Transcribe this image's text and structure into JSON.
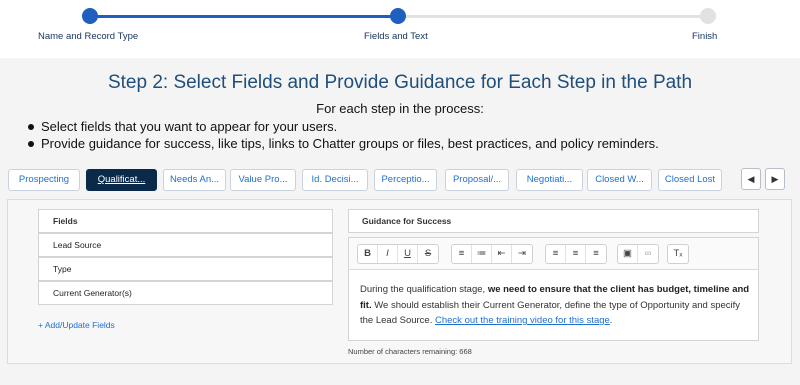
{
  "stepper": {
    "steps": [
      {
        "label": "Name and Record Type",
        "state": "complete"
      },
      {
        "label": "Fields and Text",
        "state": "current"
      },
      {
        "label": "Finish",
        "state": "incomplete"
      }
    ]
  },
  "heading": {
    "title": "Step 2: Select Fields and Provide Guidance for Each Step in the Path",
    "intro": "For each step in the process:",
    "bullets": [
      "Select fields that you want to appear for your users.",
      "Provide guidance for success, like tips, links to Chatter groups or files, best practices, and policy reminders."
    ]
  },
  "stages": {
    "tabs": [
      "Prospecting",
      "Qualificat...",
      "Needs An...",
      "Value Pro...",
      "Id. Decisi...",
      "Perceptio...",
      "Proposal/...",
      "Negotiati...",
      "Closed W...",
      "Closed Lost"
    ],
    "active_index": 1,
    "prev_icon": "chevron-left-icon",
    "next_icon": "chevron-right-icon"
  },
  "fields": {
    "header": "Fields",
    "items": [
      "Lead Source",
      "Type",
      "Current Generator(s)"
    ],
    "add_link": "+ Add/Update Fields"
  },
  "guidance": {
    "header": "Guidance for Success",
    "toolbar": {
      "bold": "B",
      "italic": "I",
      "underline": "U",
      "strike": "S"
    },
    "body": {
      "text1": "During the qualification stage, ",
      "bold": "we need to ensure that the client has budget, timeline and fit.",
      "text2": " We should establish their Current Generator, define the type of Opportunity and specify the Lead Source. ",
      "link": "Check out the training video for this stage",
      "text3": "."
    },
    "chars_remaining": "Number of characters remaining: 668"
  },
  "colors": {
    "accent": "#1f5fbf",
    "active_tab": "#0b2a4a",
    "link": "#1f6fd0"
  }
}
